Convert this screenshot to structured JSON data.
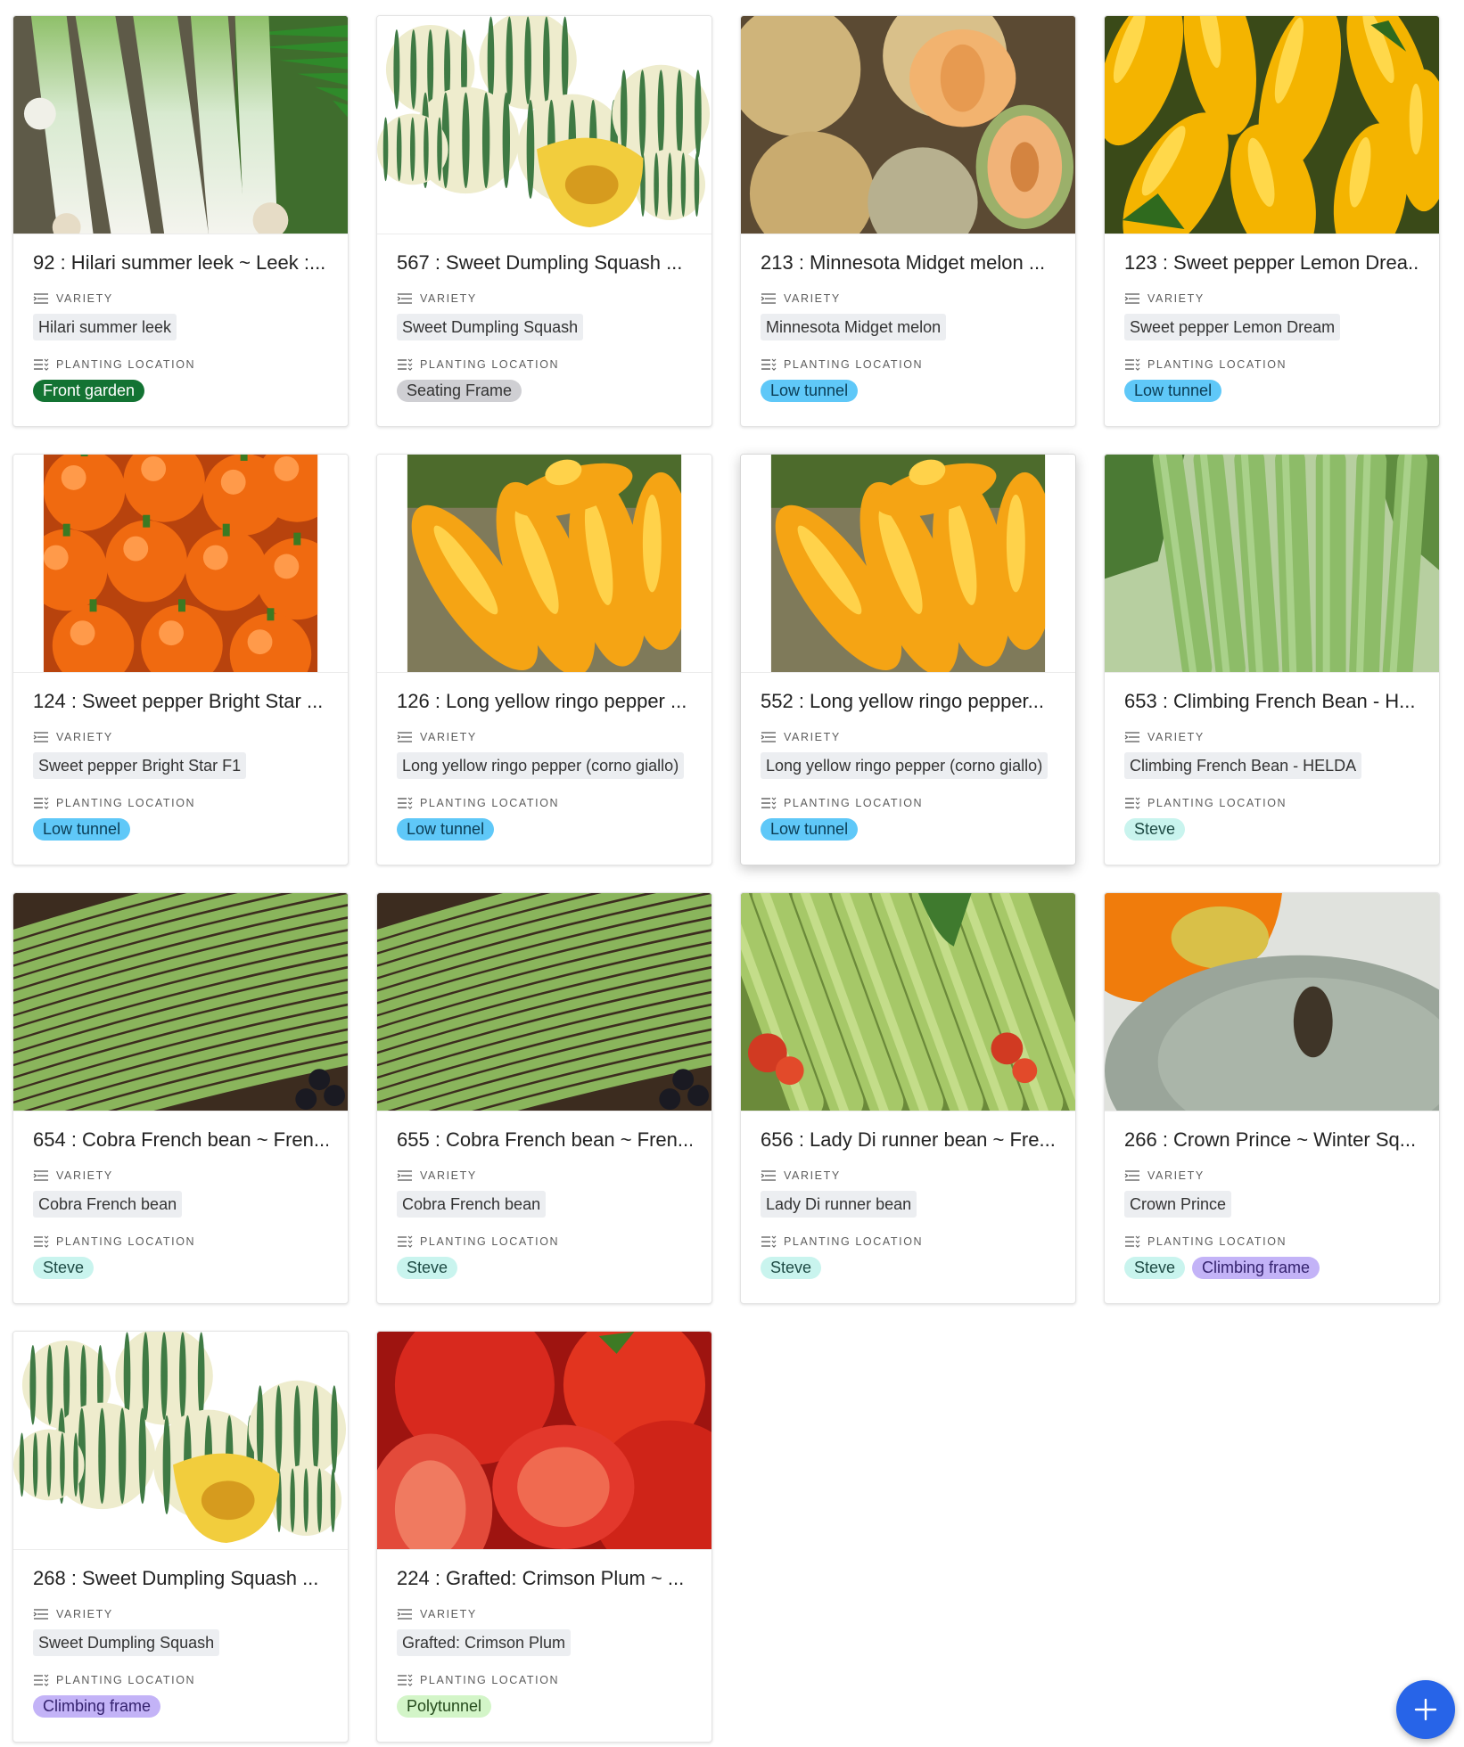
{
  "labels": {
    "variety": "VARIETY",
    "planting_location": "PLANTING LOCATION"
  },
  "location_colors": {
    "Front garden": {
      "bg": "#137333",
      "fg": "#ffffff"
    },
    "Seating Frame": {
      "bg": "#cfcfd3",
      "fg": "#333333"
    },
    "Low tunnel": {
      "bg": "#5fc8f8",
      "fg": "#0b3d55"
    },
    "Steve": {
      "bg": "#c9f4ee",
      "fg": "#1d4a44"
    },
    "Climbing frame": {
      "bg": "#c3b3f7",
      "fg": "#34226e"
    },
    "Polytunnel": {
      "bg": "#d3f5c8",
      "fg": "#254a1c"
    }
  },
  "cards": [
    {
      "title": "92 : Hilari summer leek ~ Leek :...",
      "variety": "Hilari summer leek",
      "locations": [
        "Front garden"
      ],
      "image": "leek-photo"
    },
    {
      "title": "567 : Sweet Dumpling Squash ...",
      "variety": "Sweet Dumpling Squash",
      "locations": [
        "Seating Frame"
      ],
      "image": "squash-photo"
    },
    {
      "title": "213 : Minnesota Midget melon ...",
      "variety": "Minnesota Midget melon",
      "locations": [
        "Low tunnel"
      ],
      "image": "melon-photo"
    },
    {
      "title": "123 : Sweet pepper Lemon Drea...",
      "variety": "Sweet pepper Lemon Dream",
      "locations": [
        "Low tunnel"
      ],
      "image": "yellow-pepper-photo"
    },
    {
      "title": "124 : Sweet pepper Bright Star ...",
      "variety": "Sweet pepper Bright Star F1",
      "locations": [
        "Low tunnel"
      ],
      "image": "orange-pepper-photo"
    },
    {
      "title": "126 : Long yellow ringo pepper ...",
      "variety": "Long yellow ringo pepper (corno giallo)",
      "locations": [
        "Low tunnel"
      ],
      "image": "ringo-pepper-photo"
    },
    {
      "title": "552 : Long yellow ringo pepper...",
      "variety": "Long yellow ringo pepper (corno giallo)",
      "locations": [
        "Low tunnel"
      ],
      "image": "ringo-pepper-photo"
    },
    {
      "title": "653 : Climbing French Bean - H...",
      "variety": "Climbing French Bean - HELDA",
      "locations": [
        "Steve"
      ],
      "image": "flat-bean-photo"
    },
    {
      "title": "654 : Cobra French bean ~ Fren...",
      "variety": "Cobra French bean",
      "locations": [
        "Steve"
      ],
      "image": "green-bean-photo"
    },
    {
      "title": "655 : Cobra French bean ~ Fren...",
      "variety": "Cobra French bean",
      "locations": [
        "Steve"
      ],
      "image": "green-bean-photo"
    },
    {
      "title": "656 : Lady Di runner bean ~ Fre...",
      "variety": "Lady Di runner bean",
      "locations": [
        "Steve"
      ],
      "image": "runner-bean-photo"
    },
    {
      "title": "266 : Crown Prince ~ Winter Sq...",
      "variety": "Crown Prince",
      "locations": [
        "Steve",
        "Climbing frame"
      ],
      "image": "crown-prince-photo"
    },
    {
      "title": "268 : Sweet Dumpling Squash ...",
      "variety": "Sweet Dumpling Squash",
      "locations": [
        "Climbing frame"
      ],
      "image": "squash-photo"
    },
    {
      "title": "224 : Grafted: Crimson Plum ~ ...",
      "variety": "Grafted: Crimson Plum",
      "locations": [
        "Polytunnel"
      ],
      "image": "tomato-photo"
    }
  ],
  "fab": {
    "icon": "plus-icon",
    "color": "#2764e8"
  }
}
